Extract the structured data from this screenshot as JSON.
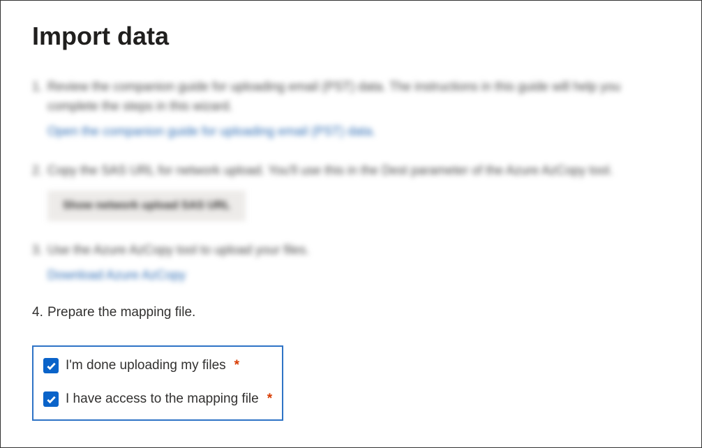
{
  "title": "Import data",
  "steps": {
    "s1": {
      "text": "Review the companion guide for uploading email (PST) data. The instructions in this guide will help you complete the steps in this wizard.",
      "link": "Open the companion guide for uploading email (PST) data."
    },
    "s2": {
      "text": "Copy the SAS URL for network upload. You'll use this in the Dest parameter of the Azure AzCopy tool.",
      "button": "Show network upload SAS URL"
    },
    "s3": {
      "text": "Use the Azure AzCopy tool to upload your files.",
      "link": "Download Azure AzCopy"
    },
    "s4": {
      "number": "4.",
      "text": "Prepare the mapping file."
    }
  },
  "checkboxes": {
    "done_uploading": {
      "label": "I'm done uploading my files",
      "required": "*",
      "checked": true
    },
    "mapping_access": {
      "label": "I have access to the mapping file",
      "required": "*",
      "checked": true
    }
  }
}
